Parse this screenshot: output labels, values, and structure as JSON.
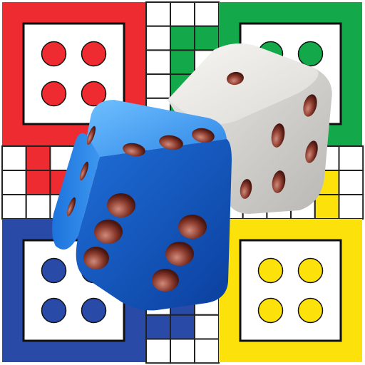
{
  "app": "ludo-icon",
  "colors": {
    "red": "#ee2b30",
    "green": "#13a84a",
    "blue": "#2a4aa8",
    "yellow": "#fde10a",
    "grid": "#222222",
    "blue_die": "#2f86e6",
    "white_die": "#ecebe8",
    "pip": "#7a2d22"
  },
  "homes": [
    {
      "color": "red",
      "tokens": 4
    },
    {
      "color": "green",
      "tokens": 4
    },
    {
      "color": "blue",
      "tokens": 4
    },
    {
      "color": "yellow",
      "tokens": 4
    }
  ],
  "dice": [
    {
      "color": "blue",
      "top_face": 3,
      "front_face": 6
    },
    {
      "color": "white",
      "top_face": 1,
      "side_face": 5
    }
  ]
}
